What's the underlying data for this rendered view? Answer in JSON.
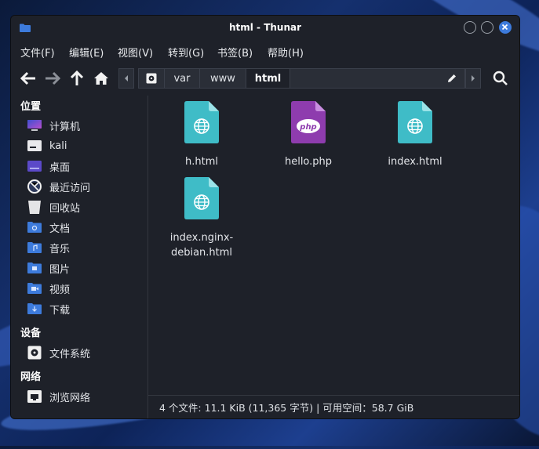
{
  "window": {
    "title": "html - Thunar"
  },
  "menubar": [
    "文件(F)",
    "编辑(E)",
    "视图(V)",
    "转到(G)",
    "书签(B)",
    "帮助(H)"
  ],
  "breadcrumb": [
    "var",
    "www",
    "html"
  ],
  "sidebar": {
    "places_header": "位置",
    "places": [
      {
        "label": "计算机",
        "icon": "computer-icon"
      },
      {
        "label": "kali",
        "icon": "home-folder-icon"
      },
      {
        "label": "桌面",
        "icon": "desktop-folder-icon"
      },
      {
        "label": "最近访问",
        "icon": "recent-icon"
      },
      {
        "label": "回收站",
        "icon": "trash-icon"
      },
      {
        "label": "文档",
        "icon": "documents-folder-icon"
      },
      {
        "label": "音乐",
        "icon": "music-folder-icon"
      },
      {
        "label": "图片",
        "icon": "pictures-folder-icon"
      },
      {
        "label": "视频",
        "icon": "videos-folder-icon"
      },
      {
        "label": "下载",
        "icon": "downloads-folder-icon"
      }
    ],
    "devices_header": "设备",
    "devices": [
      {
        "label": "文件系统",
        "icon": "drive-icon"
      }
    ],
    "network_header": "网络",
    "network": [
      {
        "label": "浏览网络",
        "icon": "network-icon"
      }
    ]
  },
  "files": [
    {
      "name": "h.html",
      "icon": "html-file-icon"
    },
    {
      "name": "hello.php",
      "icon": "php-file-icon"
    },
    {
      "name": "index.html",
      "icon": "html-file-icon"
    },
    {
      "name": "index.nginx-debian.html",
      "display_lines": [
        "index.nginx-",
        "debian.html"
      ],
      "icon": "html-file-icon"
    }
  ],
  "status": "4 个文件: 11.1 KiB (11,365 字节) | 可用空间：58.7 GiB",
  "colors": {
    "accent": "#3d7bdc",
    "html_icon": "#3fbcc7",
    "php_icon": "#8e3cae",
    "window_bg": "#1e2129"
  }
}
